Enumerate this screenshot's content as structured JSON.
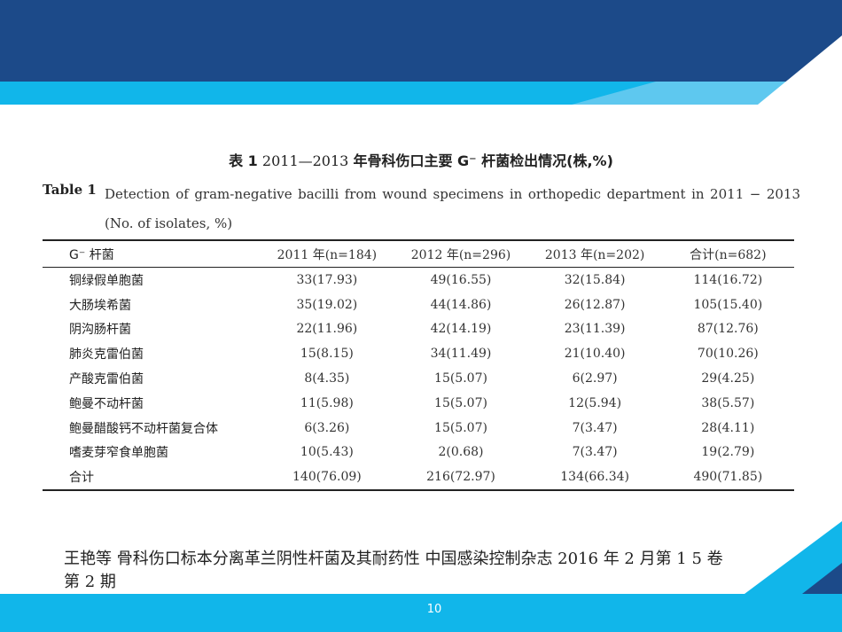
{
  "slide": {
    "page_number": "10",
    "table_title_cn_prefix": "表 1",
    "table_title_cn_years": "2011—2013",
    "table_title_cn_main": "年骨科伤口主要 G⁻ 杆菌检出情况(株,%)",
    "table_label_en": "Table 1",
    "table_title_en": "Detection of gram-negative bacilli from wound specimens in orthopedic department in 2011 − 2013 (No. of isolates, %)",
    "citation": "王艳等 骨科伤口标本分离革兰阴性杆菌及其耐药性 中国感染控制杂志 2016 年 2 月第 1 5 卷第 2 期"
  },
  "table": {
    "headers": [
      "G⁻ 杆菌",
      "2011 年(n=184)",
      "2012 年(n=296)",
      "2013 年(n=202)",
      "合计(n=682)"
    ],
    "rows": [
      [
        "铜绿假单胞菌",
        "33(17.93)",
        "49(16.55)",
        "32(15.84)",
        "114(16.72)"
      ],
      [
        "大肠埃希菌",
        "35(19.02)",
        "44(14.86)",
        "26(12.87)",
        "105(15.40)"
      ],
      [
        "阴沟肠杆菌",
        "22(11.96)",
        "42(14.19)",
        "23(11.39)",
        "87(12.76)"
      ],
      [
        "肺炎克雷伯菌",
        "15(8.15)",
        "34(11.49)",
        "21(10.40)",
        "70(10.26)"
      ],
      [
        "产酸克雷伯菌",
        "8(4.35)",
        "15(5.07)",
        "6(2.97)",
        "29(4.25)"
      ],
      [
        "鲍曼不动杆菌",
        "11(5.98)",
        "15(5.07)",
        "12(5.94)",
        "38(5.57)"
      ],
      [
        "鲍曼醋酸钙不动杆菌复合体",
        "6(3.26)",
        "15(5.07)",
        "7(3.47)",
        "28(4.11)"
      ],
      [
        "嗜麦芽窄食单胞菌",
        "10(5.43)",
        "2(0.68)",
        "7(3.47)",
        "19(2.79)"
      ]
    ],
    "total": [
      "合计",
      "140(76.09)",
      "216(72.97)",
      "134(66.34)",
      "490(71.85)"
    ]
  }
}
